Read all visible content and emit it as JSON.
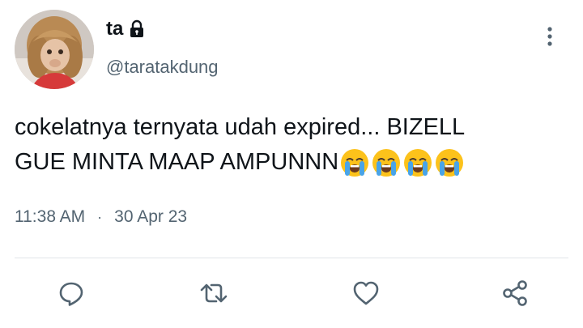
{
  "tweet": {
    "display_name": "ta",
    "handle": "@taratakdung",
    "text_line1": "cokelatnya ternyata udah expired... BIZELL",
    "text_line2": "GUE MINTA MAAP AMPUNNN",
    "emojis": [
      "loudly-crying-face",
      "loudly-crying-face",
      "loudly-crying-face",
      "loudly-crying-face"
    ],
    "time": "11:38 AM",
    "separator": "·",
    "date": "30 Apr 23"
  },
  "icons": {
    "lock": "lock-icon",
    "more": "more-vertical-icon",
    "reply": "reply-icon",
    "retweet": "retweet-icon",
    "like": "heart-icon",
    "share": "share-icon"
  },
  "colors": {
    "text_primary": "#0f1419",
    "text_secondary": "#536471",
    "divider": "#e1e5e8"
  }
}
